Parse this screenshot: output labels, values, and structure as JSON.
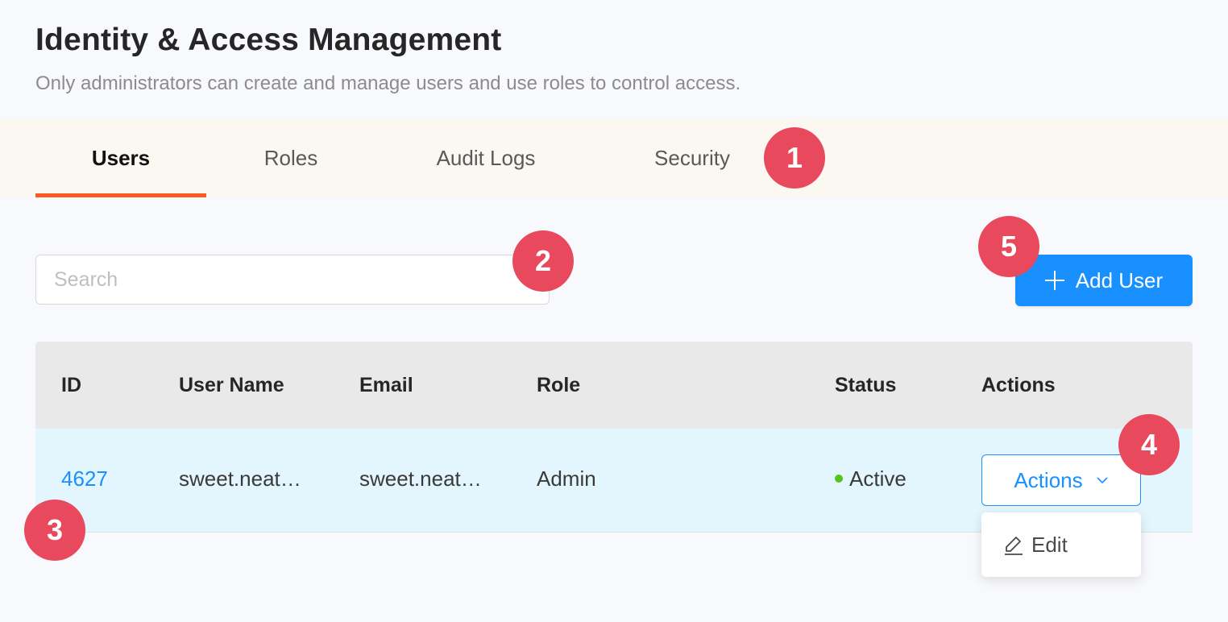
{
  "header": {
    "title": "Identity & Access Management",
    "subtitle": "Only administrators can create and manage users and use roles to control access."
  },
  "tabs": [
    {
      "label": "Users",
      "active": true
    },
    {
      "label": "Roles",
      "active": false
    },
    {
      "label": "Audit Logs",
      "active": false
    },
    {
      "label": "Security",
      "active": false
    }
  ],
  "badges": [
    "1",
    "2",
    "3",
    "4",
    "5"
  ],
  "search": {
    "placeholder": "Search",
    "value": ""
  },
  "add_user_button": {
    "label": "Add User",
    "icon": "plus-icon"
  },
  "table": {
    "columns": [
      "ID",
      "User Name",
      "Email",
      "Role",
      "Status",
      "Actions"
    ],
    "rows": [
      {
        "id": "4627",
        "user_name": "sweet.neat…",
        "email": "sweet.neat…",
        "role": "Admin",
        "status": "Active"
      }
    ]
  },
  "actions_menu": {
    "button_label": "Actions",
    "items": [
      {
        "label": "Edit",
        "icon": "edit-icon"
      }
    ]
  },
  "colors": {
    "accent": "#1890ff",
    "tab_ink": "#ff5a1f",
    "badge": "#e8495c",
    "status_active": "#52c41a"
  }
}
